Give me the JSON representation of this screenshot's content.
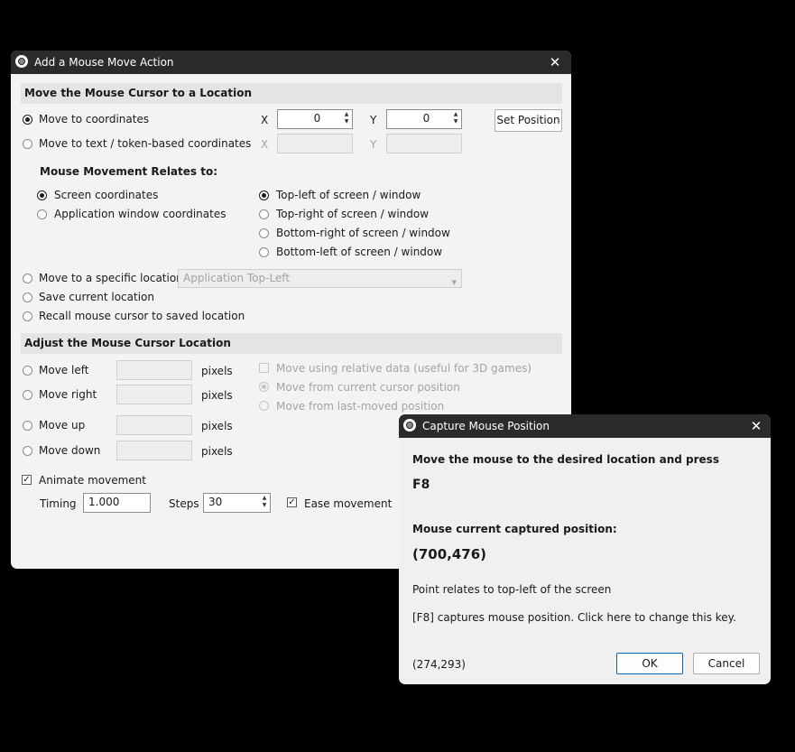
{
  "main_dialog": {
    "title": "Add a Mouse Move Action",
    "section_move": "Move the Mouse Cursor to a Location",
    "move_to_coordinates": "Move to coordinates",
    "move_to_text_coords": "Move to text / token-based coordinates",
    "x_label": "X",
    "y_label": "Y",
    "x_value": "0",
    "y_value": "0",
    "set_position": "Set Position",
    "relates_heading": "Mouse Movement Relates to:",
    "screen_coords": "Screen coordinates",
    "app_window_coords": "Application window coordinates",
    "top_left": "Top-left of screen / window",
    "top_right": "Top-right of screen / window",
    "bottom_right": "Bottom-right of screen / window",
    "bottom_left": "Bottom-left of screen / window",
    "move_specific": "Move to a specific location",
    "specific_select": "Application Top-Left",
    "save_location": "Save current location",
    "recall_location": "Recall mouse cursor to saved location",
    "section_adjust": "Adjust the Mouse Cursor Location",
    "move_left": "Move left",
    "move_right": "Move right",
    "move_up": "Move up",
    "move_down": "Move down",
    "pixels": "pixels",
    "relative_data": "Move using relative data (useful for 3D games)",
    "from_current": "Move from current cursor position",
    "from_last": "Move from last-moved position",
    "animate": "Animate movement",
    "timing_label": "Timing",
    "timing_value": "1.000",
    "steps_label": "Steps",
    "steps_value": "30",
    "ease": "Ease movement"
  },
  "capture_dialog": {
    "title": "Capture Mouse Position",
    "instruction": "Move the mouse to the desired location and press",
    "key": "F8",
    "captured_label": "Mouse current captured position:",
    "captured_value": "(700,476)",
    "relates_text": "Point relates to top-left of the screen",
    "hotkey_text": "[F8] captures mouse position.  Click here to change this key.",
    "live_coords": "(274,293)",
    "ok": "OK",
    "cancel": "Cancel"
  },
  "icons": {
    "app": "app-logo-icon",
    "close": "close-icon"
  }
}
